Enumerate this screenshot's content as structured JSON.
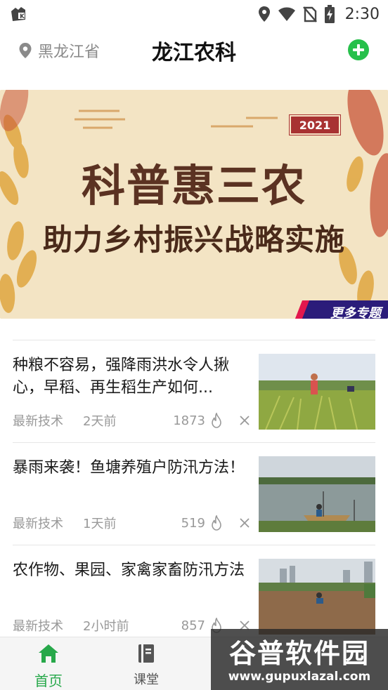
{
  "status_bar": {
    "time": "2:30",
    "icons": [
      "app-notification-icon",
      "location-icon",
      "wifi-icon",
      "no-sim-icon",
      "battery-charging-icon"
    ]
  },
  "header": {
    "location": "黑龙江省",
    "title": "龙江农科",
    "add_icon": "plus-circle-icon",
    "accent_color": "#27c04b"
  },
  "banner": {
    "year": "2021",
    "line1": "科普惠三农",
    "line2": "助力乡村振兴战略实施",
    "more_label": "更多专题"
  },
  "news": [
    {
      "title": "种粮不容易，强降雨洪水令人揪心，早稻、再生稻生产如何...",
      "category": "最新技术",
      "time": "2天前",
      "views": "1873"
    },
    {
      "title": "暴雨来袭！鱼塘养殖户防汛方法！",
      "category": "最新技术",
      "time": "1天前",
      "views": "519"
    },
    {
      "title": "农作物、果园、家禽家畜防汛方法",
      "category": "最新技术",
      "time": "2小时前",
      "views": "857"
    }
  ],
  "bottom_nav": {
    "items": [
      {
        "label": "首页",
        "icon": "home-icon",
        "active": true
      },
      {
        "label": "课堂",
        "icon": "book-icon",
        "active": false
      }
    ],
    "active_color": "#27a84a"
  },
  "watermark": {
    "name": "谷普软件园",
    "url": "www.gupuxlazal.com"
  }
}
